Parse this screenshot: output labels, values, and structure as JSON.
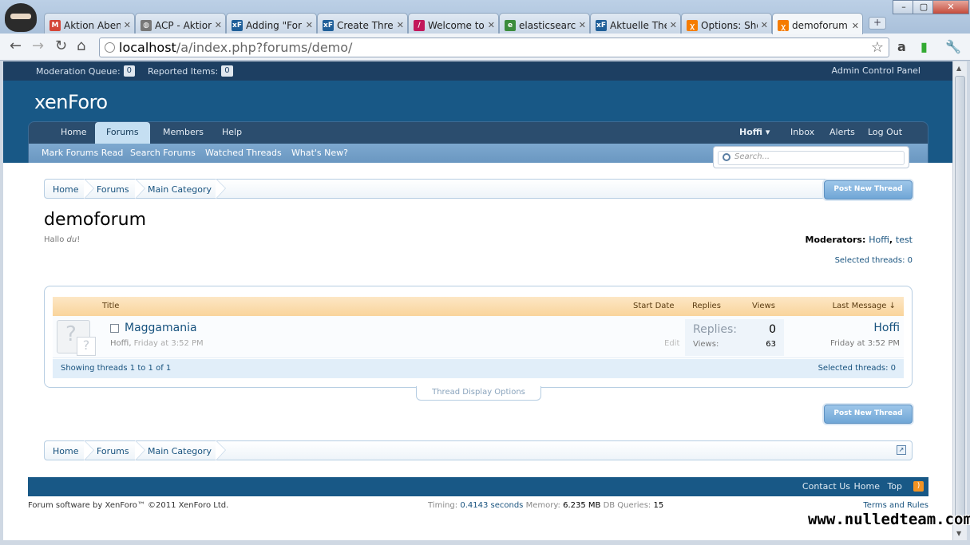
{
  "browser": {
    "tabs": [
      {
        "label": "Aktion Aben",
        "icon": "gmail-icon",
        "color": "#d44638"
      },
      {
        "label": "ACP - Aktior",
        "icon": "globe-icon",
        "color": "#777777"
      },
      {
        "label": "Adding \"For",
        "icon": "xenforo-icon",
        "color": "#1f5f99"
      },
      {
        "label": "Create Threa",
        "icon": "xenforo-icon",
        "color": "#1f5f99"
      },
      {
        "label": "Welcome to",
        "icon": "feather-icon",
        "color": "#c2185b"
      },
      {
        "label": "elasticsearch",
        "icon": "elasticsearch-icon",
        "color": "#3c8c3c"
      },
      {
        "label": "Aktuelle The",
        "icon": "xenforo-icon",
        "color": "#1f5f99"
      },
      {
        "label": "Options: Sho",
        "icon": "xampp-icon",
        "color": "#f57c00"
      },
      {
        "label": "demoforum",
        "icon": "xampp-icon",
        "color": "#f57c00"
      }
    ],
    "url_host": "localhost",
    "url_path": "/a/index.php?forums/demo/"
  },
  "modbar": {
    "moderation_queue_label": "Moderation Queue:",
    "moderation_queue_count": "0",
    "reported_items_label": "Reported Items:",
    "reported_items_count": "0",
    "admin_cp": "Admin Control Panel"
  },
  "logo": "xenForo",
  "nav": {
    "tabs": [
      "Home",
      "Forums",
      "Members",
      "Help"
    ],
    "user": "Hoffi",
    "inbox": "Inbox",
    "alerts": "Alerts",
    "logout": "Log Out",
    "sub": [
      "Mark Forums Read",
      "Search Forums",
      "Watched Threads",
      "What's New?"
    ]
  },
  "search": {
    "placeholder": "Search..."
  },
  "breadcrumb": [
    "Home",
    "Forums",
    "Main Category"
  ],
  "post_button": "Post New Thread",
  "forum": {
    "title": "demoforum",
    "desc_prefix": "Hallo ",
    "desc_em": "du",
    "desc_suffix": "!",
    "moderators_label": "Moderators:",
    "moderators": [
      "Hoffi",
      "test"
    ],
    "selected_threads": "Selected threads: 0"
  },
  "thread_list": {
    "headers": {
      "title": "Title",
      "start_date": "Start Date",
      "replies": "Replies",
      "views": "Views",
      "last_message": "Last Message ↓"
    },
    "thread": {
      "title": "Maggamania",
      "author": "Hoffi",
      "date": "Friday at 3:52 PM",
      "edit": "Edit",
      "replies_label": "Replies:",
      "replies": "0",
      "views_label": "Views:",
      "views": "63",
      "last_user": "Hoffi",
      "last_time": "Friday at 3:52 PM"
    },
    "showing": "Showing threads 1 to 1 of 1",
    "selected": "Selected threads: 0",
    "display_options": "Thread Display Options"
  },
  "footer": {
    "links": [
      "Contact Us",
      "Home",
      "Top"
    ],
    "copyright": "Forum software by XenForo™ ©2011 XenForo Ltd.",
    "timing_label": "Timing:",
    "timing": "0.4143 seconds",
    "memory_label": "Memory:",
    "memory": "6.235 MB",
    "queries_label": "DB Queries:",
    "queries": "15",
    "terms": "Terms and Rules"
  },
  "watermark": "www.nulledteam.com"
}
